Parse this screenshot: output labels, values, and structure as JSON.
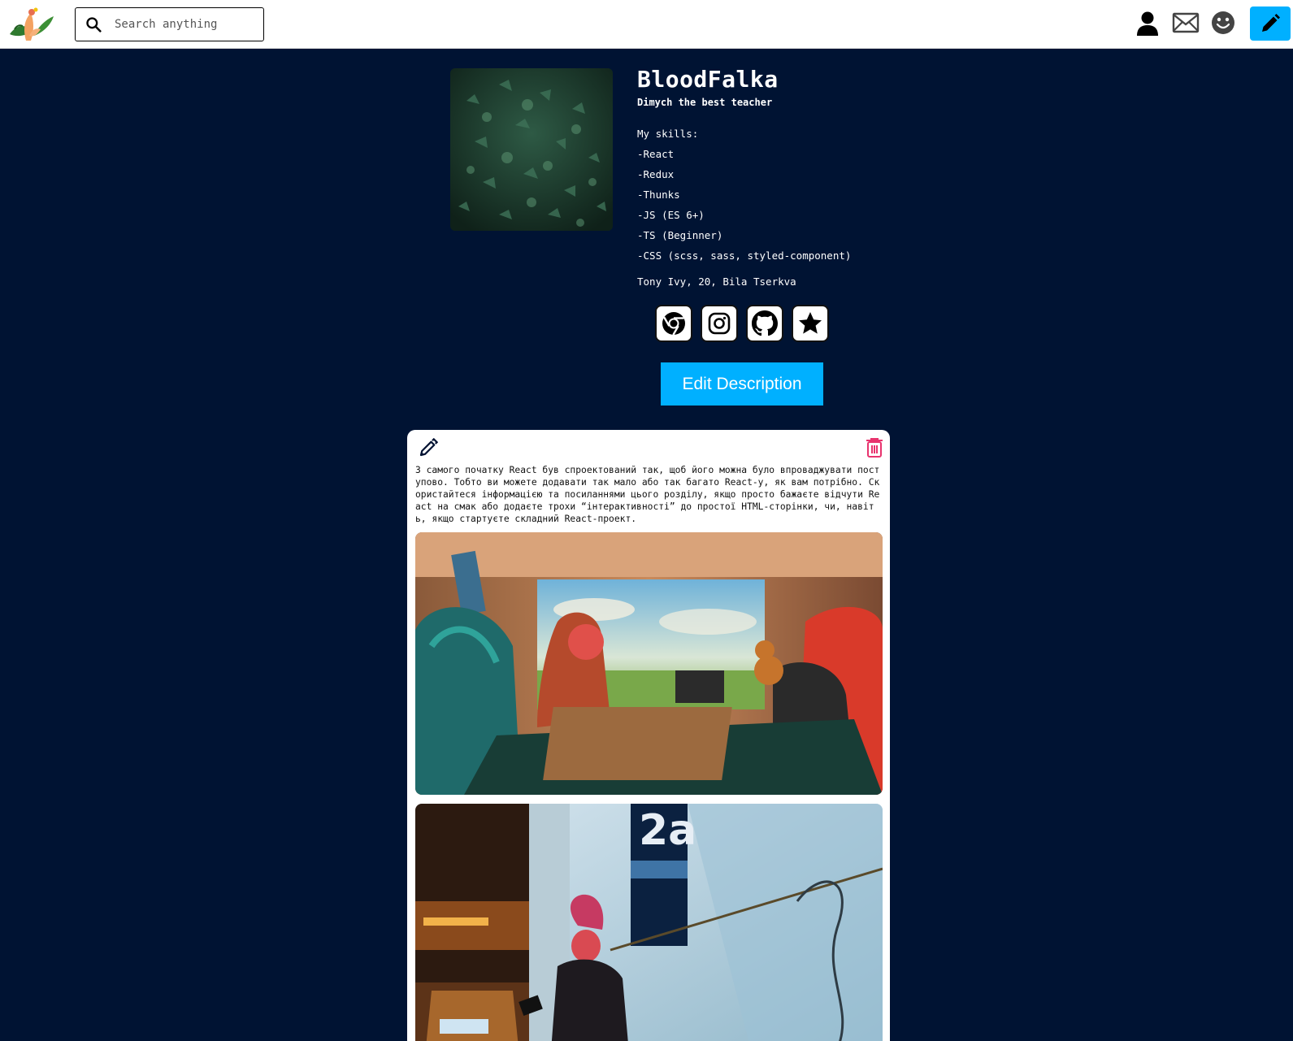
{
  "header": {
    "search_placeholder": "Search anything"
  },
  "profile": {
    "name": "BloodFalka",
    "status": "Dimych the best teacher",
    "skills": [
      "My skills:",
      "-React",
      "-Redux",
      "-Thunks",
      "-JS (ES 6+)",
      "-TS (Beginner)",
      "-CSS (scss, sass, styled-component)"
    ],
    "about": "Tony Ivy, 20, Bila Tserkva",
    "socials": [
      "chrome-icon",
      "instagram-icon",
      "github-icon",
      "star-icon"
    ],
    "edit_button": "Edit Description"
  },
  "post": {
    "text": "З самого початку React був спроектований так, щоб його можна було впроваджувати поступово. Тобто ви можете додавати так мало або так багато React-у, як вам потрібно. Скористайтеся інформацією та посиланнями цього розділу, якщо просто бажаєте відчути React на смак або додаєте трохи “інтерактивності” до простої HTML-сторінки, чи, навіть, якщо стартуєте складний React-проект."
  },
  "colors": {
    "background": "#001333",
    "accent": "#00b0ff",
    "delete": "#e8336e"
  }
}
